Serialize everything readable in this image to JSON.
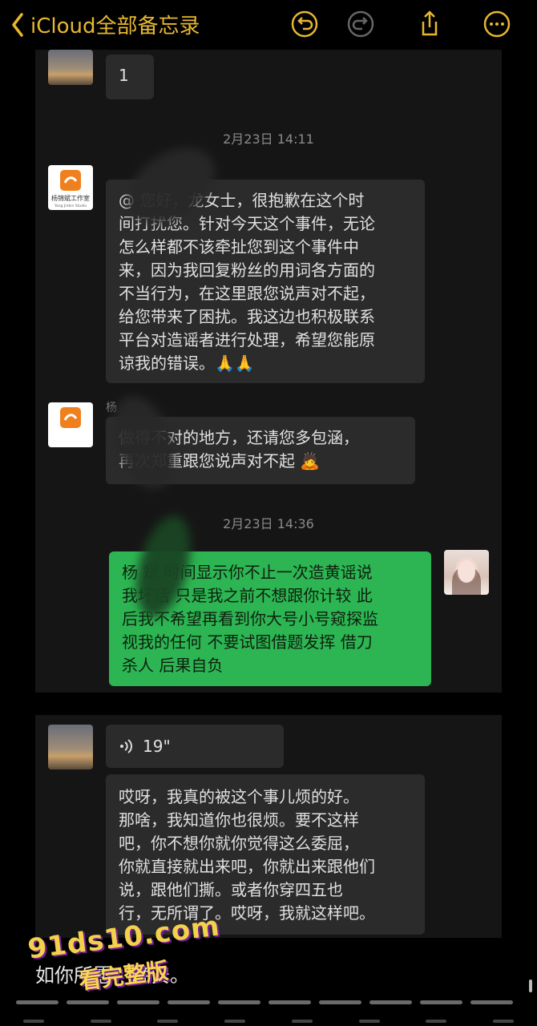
{
  "nav": {
    "back_label": "iCloud全部备忘录",
    "icons": [
      "undo-icon",
      "redo-icon",
      "share-icon",
      "more-icon"
    ],
    "accent": "#e8b730"
  },
  "chat1": {
    "first_message": "1",
    "timestamp1": "2月23日 14:11",
    "msg_apology": [
      "@ 您好，龙女士，很抱歉在这个时",
      "间打扰您。针对今天这个事件，无论",
      "怎么样都不该牵扯您到这个事件中",
      "来，因为我回复粉丝的用词各方面的",
      "不当行为，在这里跟您说声对不起，",
      "给您带来了困扰。我这边也积极联系",
      "平台对造谣者进行处理，希望您能原",
      "谅我的错误。🙏🙏"
    ],
    "sender2": "杨",
    "msg_followup": [
      "做得不对的地方，还请您多包涵，",
      "再次郑重跟您说声对不起 🙇"
    ],
    "timestamp2": "2月23日 14:36",
    "msg_green": [
      "杨 斌 时间显示你不止一次造黄谣说",
      "我坏话 只是我之前不想跟你计较 此",
      "后我不希望再看到你大号小号窥探监",
      "视我的任何 不要试图借题发挥 借刀",
      "杀人 后果自负"
    ],
    "studio_logo_text": "杨锦斌工作室",
    "studio_logo_sub": "Yang Jinbin Studio"
  },
  "chat2": {
    "voice_duration": "19\"",
    "msg_voice_text": [
      "哎呀，我真的被这个事儿烦的好。",
      "那啥，我知道你也很烦。要不这样",
      "吧，你不想你就你觉得这么委屈，",
      "你就直接就出来吧，你就出来跟他们",
      "说，跟他们撕。或者你穿四五也",
      "行，无所谓了。哎呀，我就这样吧。"
    ]
  },
  "caption": "如你所愿，晚安。",
  "watermark": {
    "site": "91ds10.com",
    "slogan": "看完整版"
  }
}
